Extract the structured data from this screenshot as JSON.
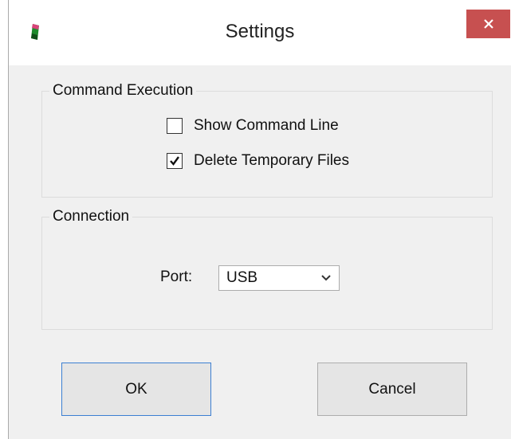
{
  "window": {
    "title": "Settings",
    "close_icon": "close-icon",
    "app_icon": "app-icon",
    "close_color": "#c75050"
  },
  "command_execution": {
    "label": "Command Execution",
    "show_command_line": {
      "label": "Show Command Line",
      "checked": false
    },
    "delete_temporary_files": {
      "label": "Delete Temporary Files",
      "checked": true
    }
  },
  "connection": {
    "label": "Connection",
    "port_label": "Port:",
    "port_value": "USB",
    "dropdown_icon": "chevron-down-icon"
  },
  "buttons": {
    "ok": "OK",
    "cancel": "Cancel",
    "focus_color": "#3c7fd2"
  }
}
